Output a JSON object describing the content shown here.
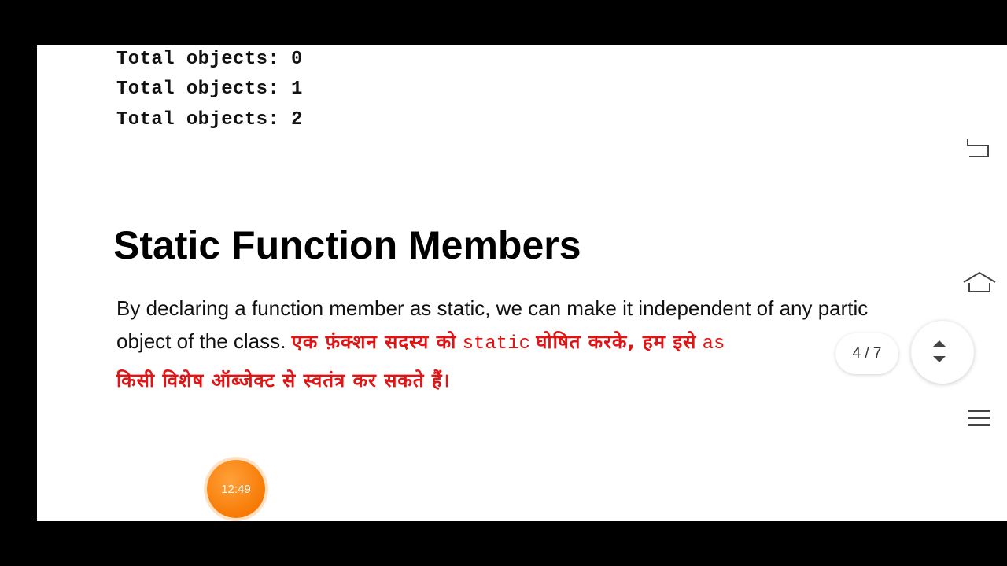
{
  "code_output": [
    "Total objects: 0",
    "Total objects: 1",
    "Total objects: 2"
  ],
  "heading": "Static Function Members",
  "paragraph": {
    "line1": "By declaring a function member as static, we can make it independent of any partic",
    "line2_en": "object of the class.",
    "line2_hi_a": "एक फ़ंक्शन सदस्य को",
    "line2_code": "static",
    "line2_hi_b": "घोषित करके, हम इसे",
    "line2_tail": "as",
    "line3_hi": "किसी विशेष ऑब्जेक्ट से स्वतंत्र कर सकते हैं।"
  },
  "page_indicator": "4 / 7",
  "timer": "12:49",
  "nav": {
    "icons": [
      "back-icon",
      "home-icon",
      "menu-icon"
    ]
  },
  "colors": {
    "hindi_text": "#e01414",
    "timer_bg": "#f77a05"
  }
}
